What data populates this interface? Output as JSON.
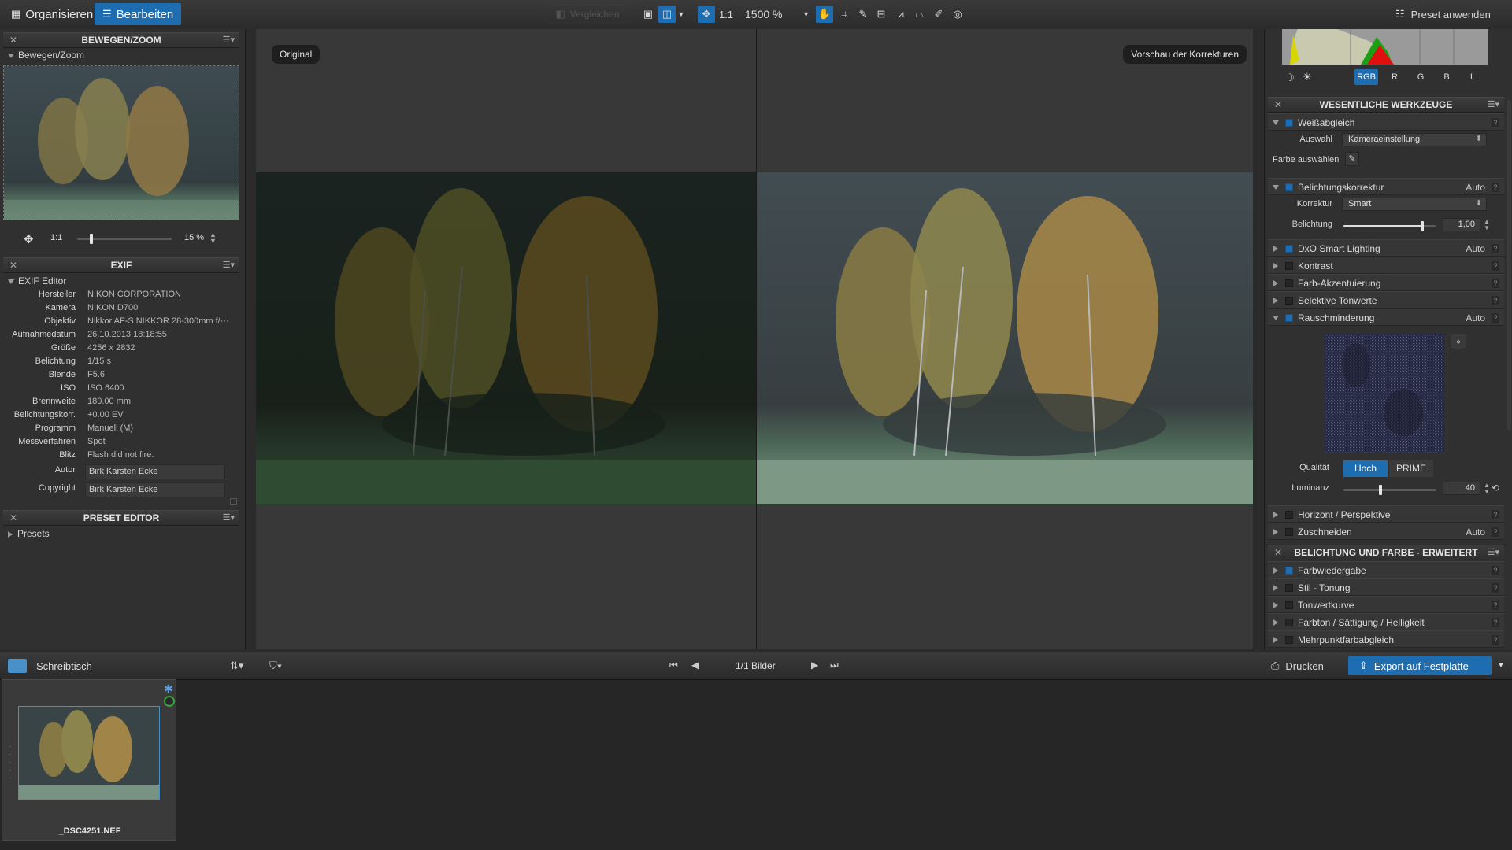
{
  "topbar": {
    "organize": "Organisieren",
    "edit": "Bearbeiten",
    "compare": "Vergleichen",
    "one_to_one": "1:1",
    "zoom": "1500 %",
    "preset_apply": "Preset anwenden"
  },
  "left": {
    "move_zoom": {
      "header": "BEWEGEN/ZOOM",
      "sub": "Bewegen/Zoom",
      "one_to_one": "1:1",
      "zoom_value": "15 %"
    },
    "exif": {
      "header": "EXIF",
      "sub": "EXIF Editor",
      "rows": [
        {
          "k": "Hersteller",
          "v": "NIKON CORPORATION"
        },
        {
          "k": "Kamera",
          "v": "NIKON D700"
        },
        {
          "k": "Objektiv",
          "v": "Nikkor AF-S NIKKOR 28-300mm f/···"
        },
        {
          "k": "Aufnahmedatum",
          "v": "26.10.2013 18:18:55"
        },
        {
          "k": "Größe",
          "v": "4256 x 2832"
        },
        {
          "k": "Belichtung",
          "v": "1/15 s"
        },
        {
          "k": "Blende",
          "v": "F5.6"
        },
        {
          "k": "ISO",
          "v": "ISO 6400"
        },
        {
          "k": "Brennweite",
          "v": "180.00 mm"
        },
        {
          "k": "Belichtungskorr.",
          "v": "+0.00 EV"
        },
        {
          "k": "Programm",
          "v": "Manuell (M)"
        },
        {
          "k": "Messverfahren",
          "v": "Spot"
        },
        {
          "k": "Blitz",
          "v": "Flash did not fire."
        }
      ],
      "author_label": "Autor",
      "author": "Birk Karsten Ecke",
      "copyright_label": "Copyright",
      "copyright": "Birk Karsten Ecke"
    },
    "preset": {
      "header": "PRESET EDITOR",
      "sub": "Presets"
    }
  },
  "viewer": {
    "original": "Original",
    "preview": "Vorschau der Korrekturen"
  },
  "right": {
    "histo": {
      "channels": [
        "RGB",
        "R",
        "G",
        "B",
        "L"
      ]
    },
    "essential": {
      "header": "WESENTLICHE WERKZEUGE",
      "wb": "Weißabgleich",
      "wb_sel_label": "Auswahl",
      "wb_sel": "Kameraeinstellung",
      "pick_color": "Farbe auswählen",
      "exposure": "Belichtungskorrektur",
      "exposure_auto": "Auto",
      "corr_label": "Korrektur",
      "corr": "Smart",
      "bel_label": "Belichtung",
      "bel_value": "1,00",
      "bel_pos": 0.85,
      "smart_lighting": "DxO Smart Lighting",
      "smart_auto": "Auto",
      "contrast": "Kontrast",
      "color_accent": "Farb-Akzentuierung",
      "selective_tone": "Selektive Tonwerte",
      "noise": "Rauschminderung",
      "noise_auto": "Auto",
      "quality_label": "Qualität",
      "quality_high": "Hoch",
      "quality_prime": "PRIME",
      "lum_label": "Luminanz",
      "lum_value": "40",
      "lum_pos": 0.4,
      "horizon": "Horizont / Perspektive",
      "crop": "Zuschneiden",
      "crop_auto": "Auto"
    },
    "advanced": {
      "header": "BELICHTUNG UND FARBE - ERWEITERT",
      "items": [
        "Farbwiedergabe",
        "Stil - Tonung",
        "Tonwertkurve",
        "Farbton / Sättigung / Helligkeit",
        "Mehrpunktfarbabgleich"
      ]
    }
  },
  "bottom": {
    "folder": "Schreibtisch",
    "count": "1/1 Bilder",
    "print": "Drucken",
    "export": "Export auf Festplatte",
    "thumb_name": "_DSC4251.NEF"
  }
}
